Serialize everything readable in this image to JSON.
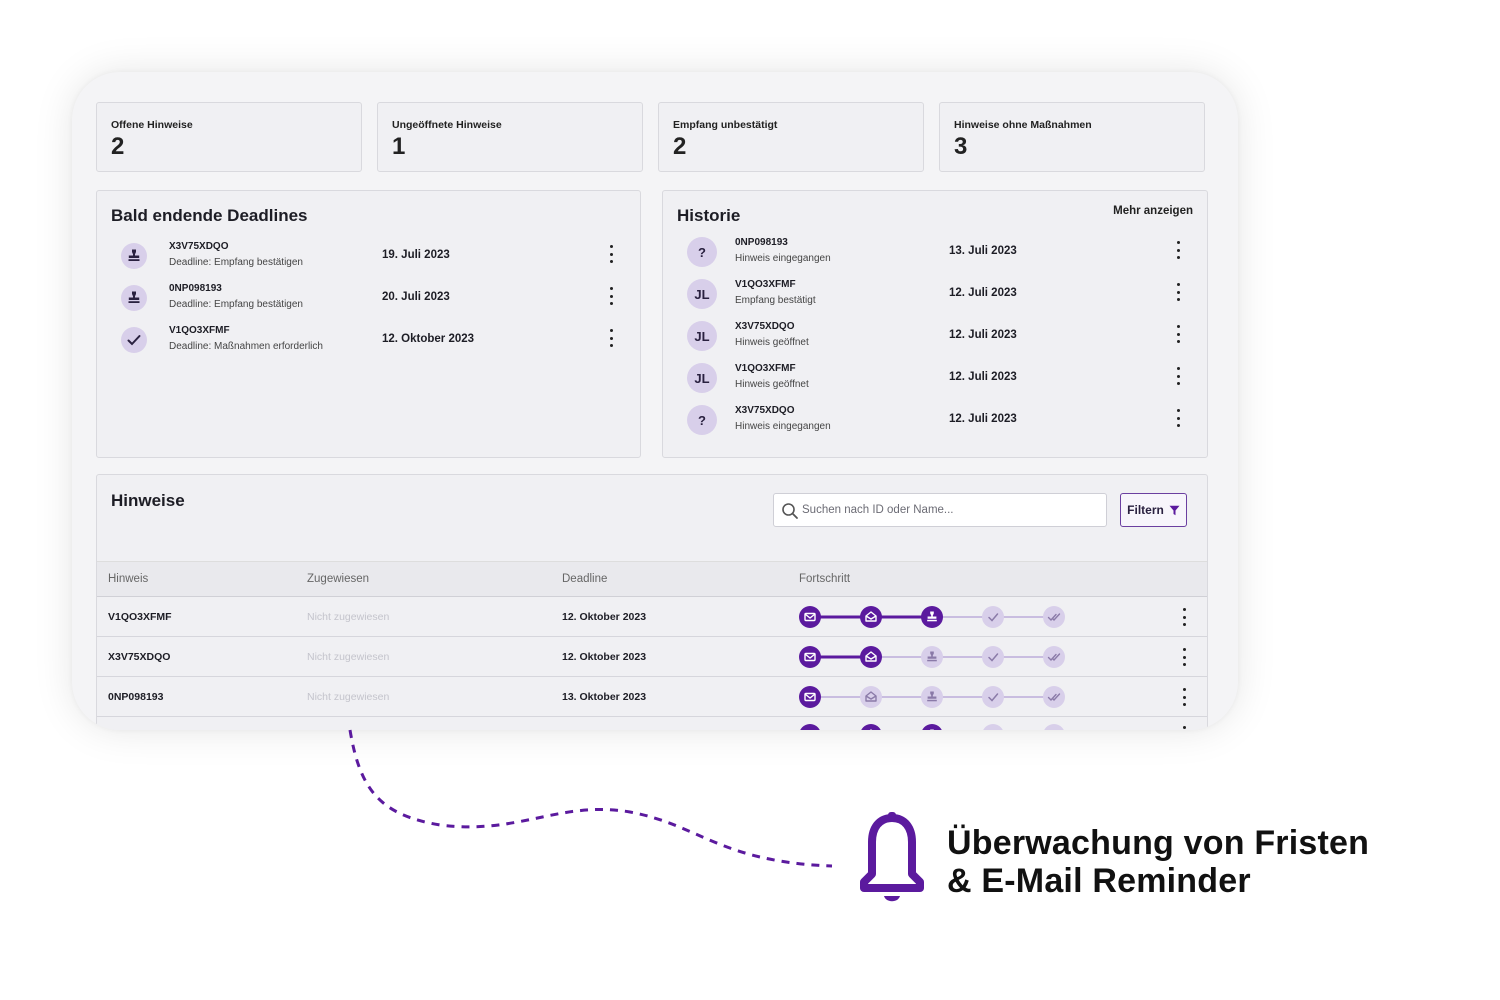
{
  "stats": [
    {
      "label": "Offene Hinweise",
      "value": "2"
    },
    {
      "label": "Ungeöffnete Hinweise",
      "value": "1"
    },
    {
      "label": "Empfang unbestätigt",
      "value": "2"
    },
    {
      "label": "Hinweise ohne Maßnahmen",
      "value": "3"
    }
  ],
  "deadlines": {
    "title": "Bald endende Deadlines",
    "items": [
      {
        "icon": "stamp-icon",
        "id": "X3V75XDQO",
        "sub": "Deadline: Empfang bestätigen",
        "date": "19. Juli 2023"
      },
      {
        "icon": "stamp-icon",
        "id": "0NP098193",
        "sub": "Deadline: Empfang bestätigen",
        "date": "20. Juli 2023"
      },
      {
        "icon": "check-icon",
        "id": "V1QO3XFMF",
        "sub": "Deadline: Maßnahmen erforderlich",
        "date": "12. Oktober 2023"
      }
    ]
  },
  "history": {
    "title": "Historie",
    "more": "Mehr anzeigen",
    "items": [
      {
        "avatar": "?",
        "id": "0NP098193",
        "sub": "Hinweis eingegangen",
        "date": "13. Juli 2023"
      },
      {
        "avatar": "JL",
        "id": "V1QO3XFMF",
        "sub": "Empfang bestätigt",
        "date": "12. Juli 2023"
      },
      {
        "avatar": "JL",
        "id": "X3V75XDQO",
        "sub": "Hinweis geöffnet",
        "date": "12. Juli 2023"
      },
      {
        "avatar": "JL",
        "id": "V1QO3XFMF",
        "sub": "Hinweis geöffnet",
        "date": "12. Juli 2023"
      },
      {
        "avatar": "?",
        "id": "X3V75XDQO",
        "sub": "Hinweis eingegangen",
        "date": "12. Juli 2023"
      }
    ]
  },
  "hinweise": {
    "title": "Hinweise",
    "search_placeholder": "Suchen nach ID oder Name...",
    "filter_label": "Filtern",
    "columns": [
      "Hinweis",
      "Zugewiesen",
      "Deadline",
      "Fortschritt"
    ],
    "rows": [
      {
        "id": "V1QO3XFMF",
        "assigned": "Nicht zugewiesen",
        "deadline": "12. Oktober 2023",
        "progress": 3
      },
      {
        "id": "X3V75XDQO",
        "assigned": "Nicht zugewiesen",
        "deadline": "12. Oktober 2023",
        "progress": 2
      },
      {
        "id": "0NP098193",
        "assigned": "Nicht zugewiesen",
        "deadline": "13. Oktober 2023",
        "progress": 1
      },
      {
        "id": "",
        "assigned": "",
        "deadline": "",
        "progress": 3
      }
    ],
    "progress_steps": [
      "mail-closed-icon",
      "mail-open-icon",
      "stamp-icon",
      "check-icon",
      "double-check-icon"
    ]
  },
  "callout": {
    "line1": "Überwachung von Fristen",
    "line2": "& E-Mail Reminder",
    "icon": "bell-icon"
  },
  "colors": {
    "accent": "#5b1a9e",
    "step_active": "#5b1a9e",
    "step_inactive": "#d8cfea",
    "line_inactive": "#c9bde0"
  }
}
